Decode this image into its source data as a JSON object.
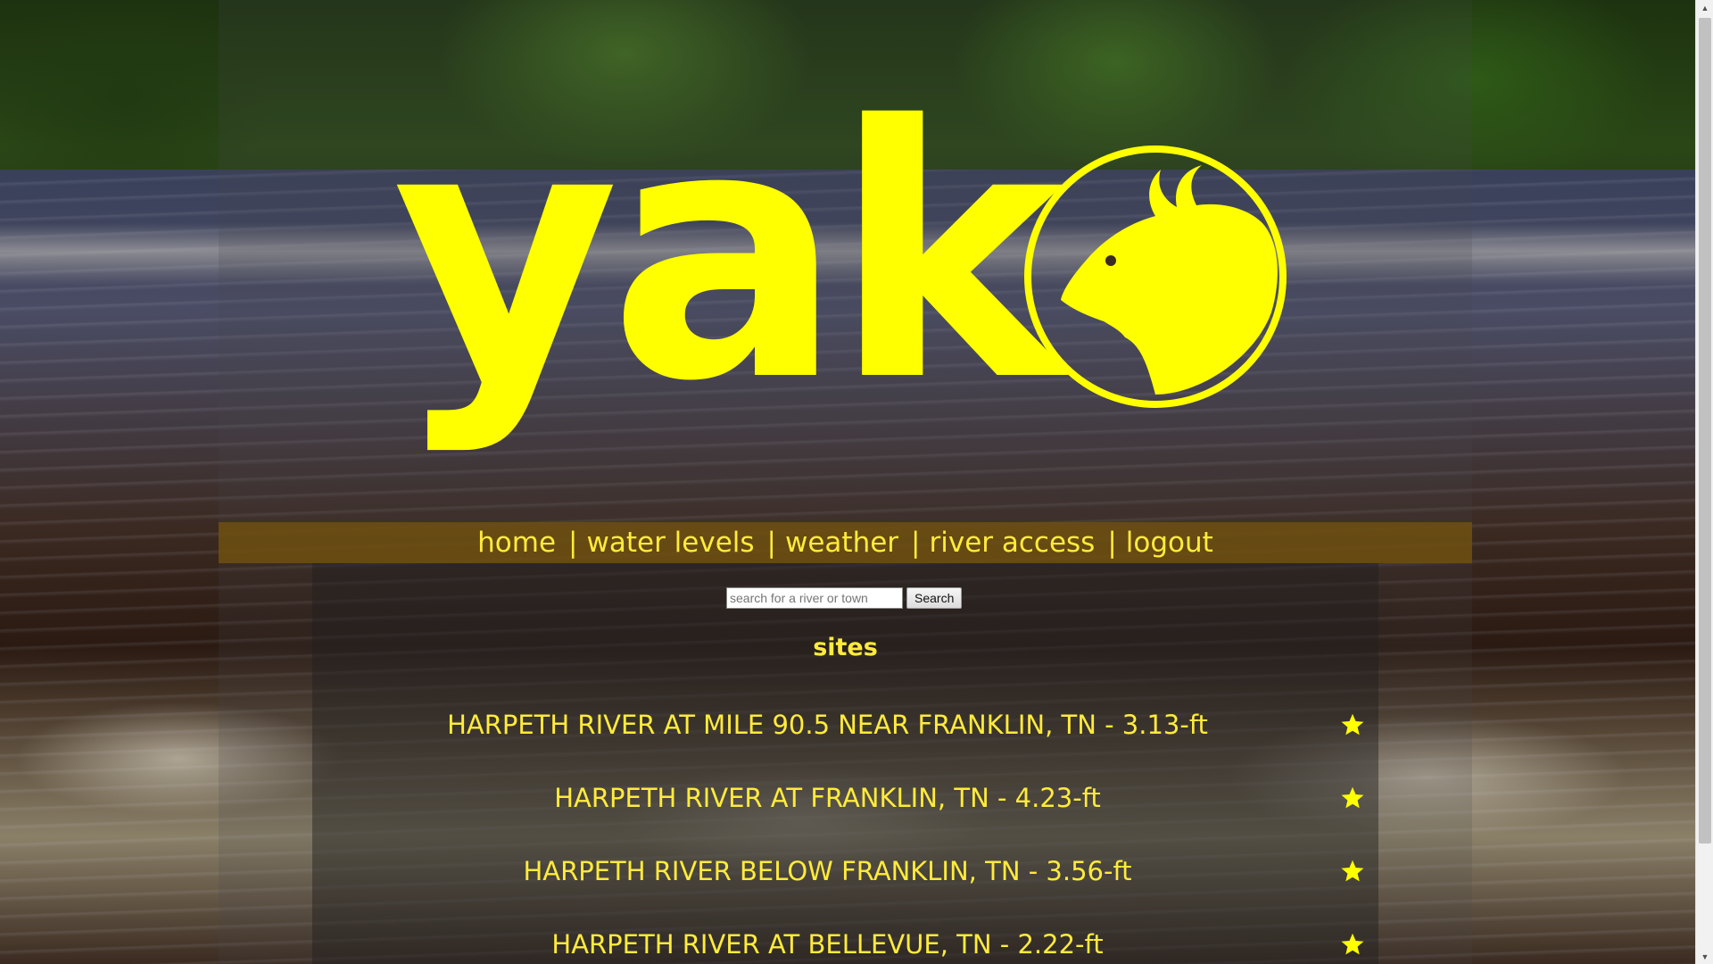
{
  "logo": {
    "text": "yak"
  },
  "nav": {
    "items": [
      {
        "label": "home"
      },
      {
        "label": "water levels"
      },
      {
        "label": "weather"
      },
      {
        "label": "river access"
      },
      {
        "label": "logout"
      }
    ],
    "separator": "|"
  },
  "search": {
    "placeholder": "search for a river or town",
    "value": "",
    "button_label": "Search"
  },
  "sites": {
    "title": "sites",
    "items": [
      {
        "label": "HARPETH RIVER AT MILE 90.5 NEAR FRANKLIN, TN - 3.13-ft",
        "starred": true
      },
      {
        "label": "HARPETH RIVER AT FRANKLIN, TN - 4.23-ft",
        "starred": true
      },
      {
        "label": "HARPETH RIVER BELOW FRANKLIN, TN - 3.56-ft",
        "starred": true
      },
      {
        "label": "HARPETH RIVER AT BELLEVUE, TN - 2.22-ft",
        "starred": true
      }
    ]
  },
  "colors": {
    "accent": "#ffff00",
    "nav_text": "#ffeb3b",
    "nav_bar": "#6e500f"
  },
  "icons": {
    "logo_emblem": "yak-head-icon",
    "favorite": "star-icon"
  }
}
